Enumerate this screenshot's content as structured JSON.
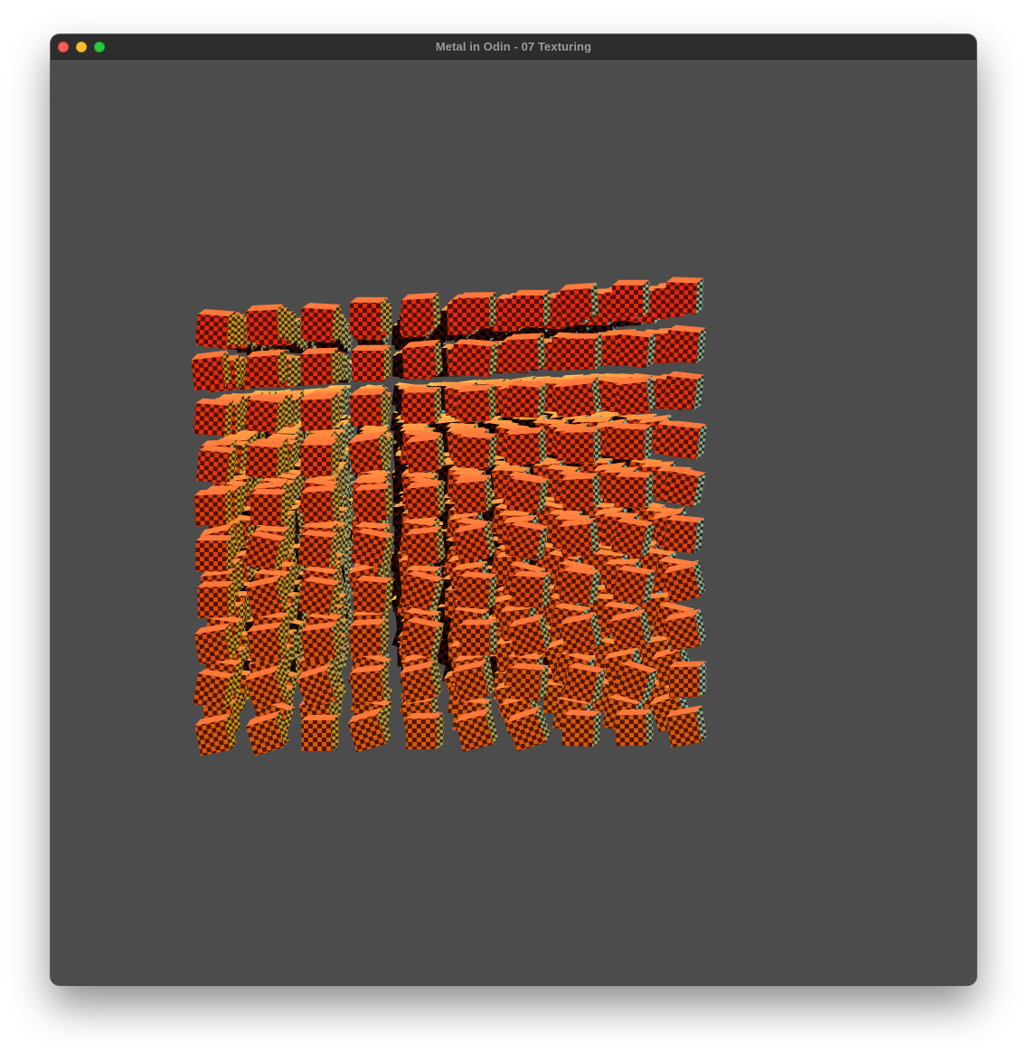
{
  "window": {
    "title": "Metal in Odin - 07 Texturing"
  },
  "colors": {
    "background": "#ffffff",
    "titlebar": "#2d2d2d",
    "title_text": "#9a9a9a",
    "clear_color": "#4c4c4c",
    "close": "#fe5f57",
    "minimize": "#febc2e",
    "zoom": "#28c840",
    "cube_front_warm": "#e0471a",
    "cube_side_cool": "#5ab8c8",
    "cube_side_green": "#30d070",
    "checker_dark": "#3a0a06"
  },
  "icons": {
    "close": "traffic-light-close-icon",
    "minimize": "traffic-light-minimize-icon",
    "zoom": "traffic-light-zoom-icon"
  },
  "scene": {
    "object": "instanced textured cubes",
    "texture": "checkerboard",
    "grid": [
      10,
      10,
      10
    ]
  }
}
